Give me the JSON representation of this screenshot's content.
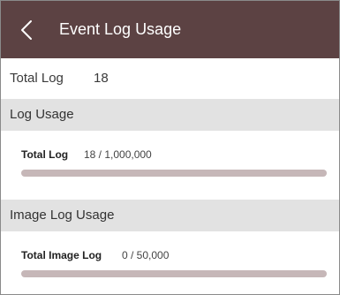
{
  "header": {
    "title": "Event Log Usage",
    "back_icon": "chevron-left-icon"
  },
  "total": {
    "label": "Total Log",
    "value": "18"
  },
  "sections": {
    "log_usage": {
      "title": "Log Usage",
      "item": {
        "label": "Total Log",
        "value": "18 / 1,000,000",
        "fraction": 1.8e-05
      }
    },
    "image_log_usage": {
      "title": "Image Log Usage",
      "item": {
        "label": "Total Image Log",
        "value": "0 / 50,000",
        "fraction": 0
      }
    }
  },
  "colors": {
    "header_bg": "#5c4243",
    "section_bg": "#e2e2e2",
    "bar_track": "#c6b7b8",
    "bar_fill": "#5c4243"
  }
}
